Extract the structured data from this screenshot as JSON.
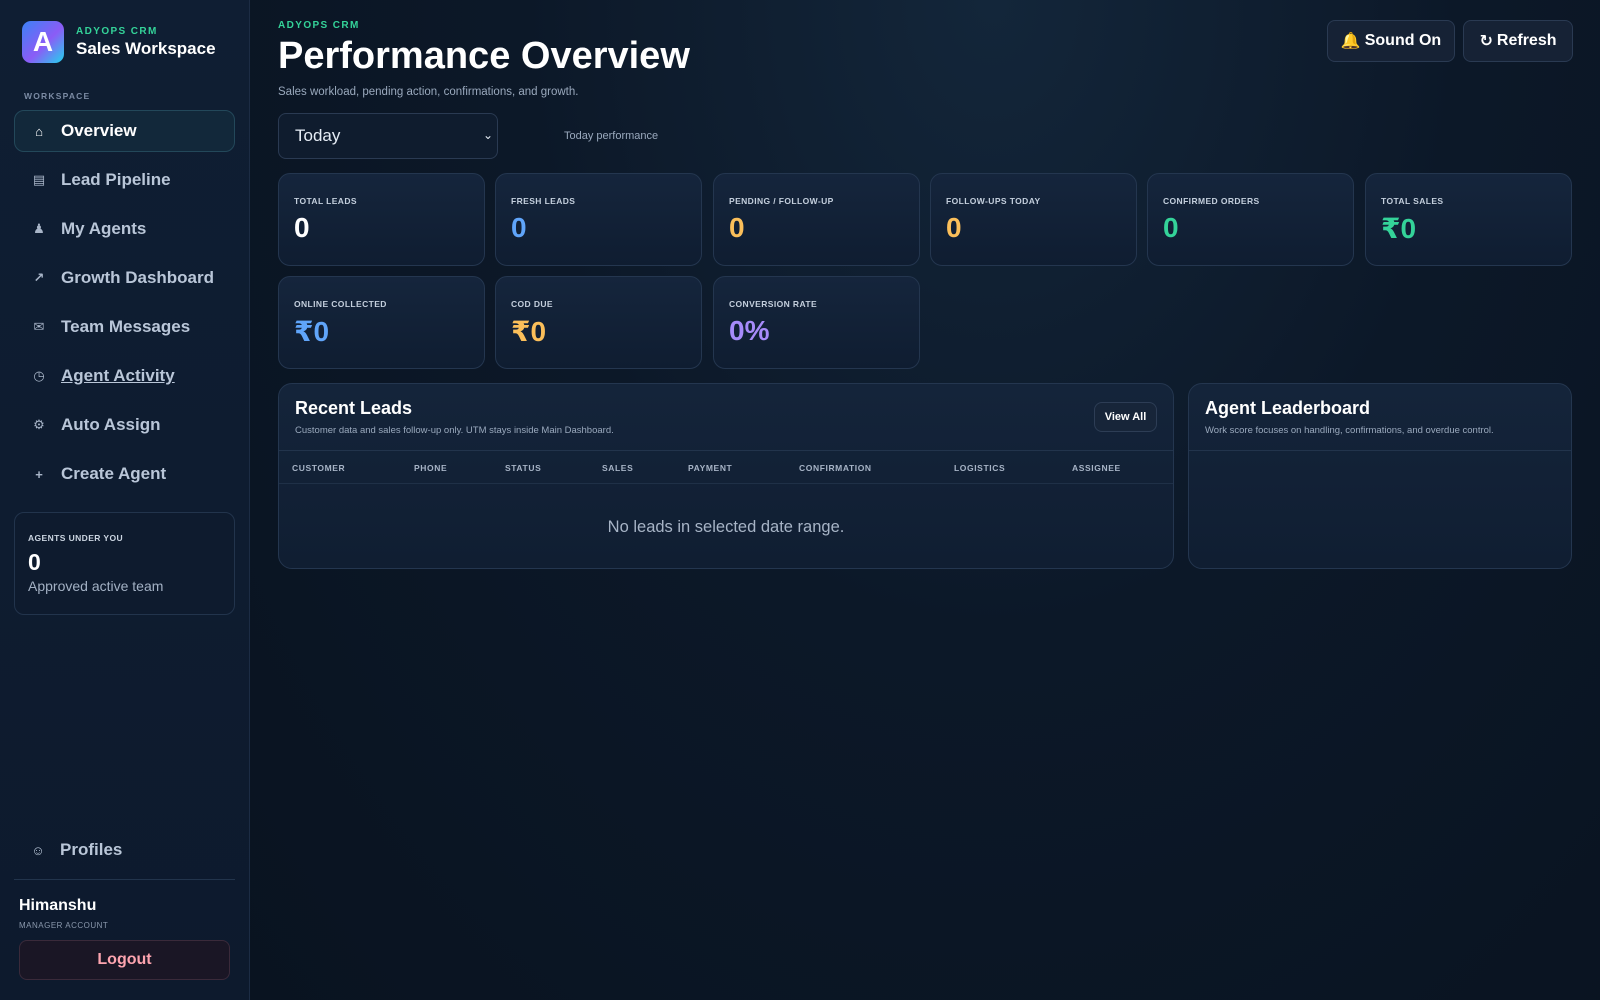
{
  "brand": {
    "eyebrow": "ADYOPS CRM",
    "title": "Sales Workspace",
    "logo_letter": "A"
  },
  "sidebar": {
    "section_label": "WORKSPACE",
    "items": [
      {
        "label": "Overview",
        "icon": "home-icon",
        "glyph": "⌂",
        "active": true
      },
      {
        "label": "Lead Pipeline",
        "icon": "list-icon",
        "glyph": "▤"
      },
      {
        "label": "My Agents",
        "icon": "user-icon",
        "glyph": "♟"
      },
      {
        "label": "Growth Dashboard",
        "icon": "arrow-up-right-icon",
        "glyph": "↗"
      },
      {
        "label": "Team Messages",
        "icon": "mail-icon",
        "glyph": "✉"
      },
      {
        "label": "Agent Activity",
        "icon": "clock-icon",
        "glyph": "◷"
      },
      {
        "label": "Auto Assign",
        "icon": "gear-icon",
        "glyph": "⚙"
      },
      {
        "label": "Create Agent",
        "icon": "plus-icon",
        "glyph": "+"
      }
    ],
    "agents_card": {
      "eyebrow": "AGENTS UNDER YOU",
      "value": "0",
      "subtitle": "Approved active team"
    },
    "profiles": {
      "label": "Profiles",
      "glyph": "☺"
    },
    "user": {
      "name": "Himanshu",
      "role": "MANAGER ACCOUNT"
    },
    "logout_label": "Logout"
  },
  "header": {
    "eyebrow": "ADYOPS CRM",
    "title": "Performance Overview",
    "subtitle": "Sales workload, pending action, confirmations, and growth.",
    "sound_label": "Sound On",
    "sound_glyph": "🔔",
    "refresh_label": "Refresh",
    "refresh_glyph": "↻"
  },
  "filter": {
    "selected": "Today",
    "chevron": "⌄",
    "caption": "Today performance"
  },
  "kpis": [
    {
      "label": "TOTAL LEADS",
      "value": "0",
      "color": "#ffffff"
    },
    {
      "label": "FRESH LEADS",
      "value": "0",
      "color": "#60a5fa"
    },
    {
      "label": "PENDING / FOLLOW-UP",
      "value": "0",
      "color": "#fbbf5a"
    },
    {
      "label": "FOLLOW-UPS TODAY",
      "value": "0",
      "color": "#fbbf5a"
    },
    {
      "label": "CONFIRMED ORDERS",
      "value": "0",
      "color": "#34d399"
    },
    {
      "label": "TOTAL SALES",
      "value": "₹0",
      "color": "#34d399"
    },
    {
      "label": "ONLINE COLLECTED",
      "value": "₹0",
      "color": "#60a5fa"
    },
    {
      "label": "COD DUE",
      "value": "₹0",
      "color": "#fbbf5a"
    },
    {
      "label": "CONVERSION RATE",
      "value": "0%",
      "color": "#a78bfa"
    }
  ],
  "recent_leads": {
    "title": "Recent Leads",
    "subtitle": "Customer data and sales follow-up only. UTM stays inside Main Dashboard.",
    "view_all_label": "View All",
    "columns": [
      "CUSTOMER",
      "PHONE",
      "STATUS",
      "SALES",
      "PAYMENT",
      "CONFIRMATION",
      "LOGISTICS",
      "ASSIGNEE"
    ],
    "empty_text": "No leads in selected date range."
  },
  "leaderboard": {
    "title": "Agent Leaderboard",
    "subtitle": "Work score focuses on handling, confirmations, and overdue control."
  }
}
